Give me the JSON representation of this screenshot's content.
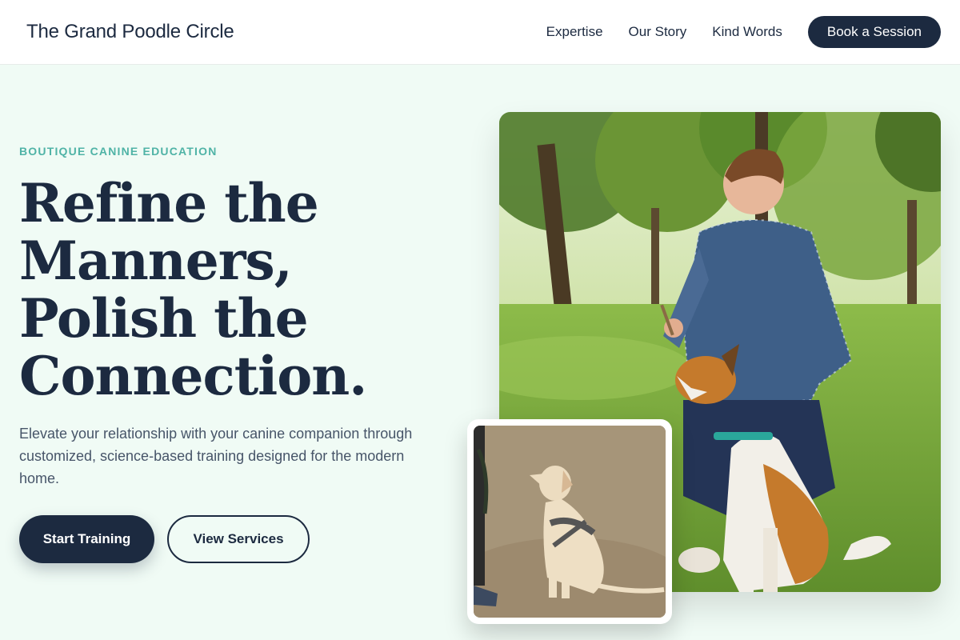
{
  "header": {
    "logo": "The Grand Poodle Circle",
    "nav": [
      "Expertise",
      "Our Story",
      "Kind Words"
    ],
    "cta": "Book a Session"
  },
  "hero": {
    "eyebrow": "BOUTIQUE CANINE EDUCATION",
    "headline": [
      "Refine the",
      "Manners,",
      "Polish the",
      "Connection."
    ],
    "lede": "Elevate your relationship with your canine companion through customized, science-based training designed for the modern home.",
    "primary_cta": "Start Training",
    "secondary_cta": "View Services"
  },
  "images": {
    "main": "photo-man-training-dog-in-park",
    "inset": "photo-labrador-sitting-on-leash"
  },
  "colors": {
    "navy": "#1c2a40",
    "accent_teal": "#4fb3a6",
    "hero_bg": "#f0fbf5",
    "body_text": "#475569"
  }
}
